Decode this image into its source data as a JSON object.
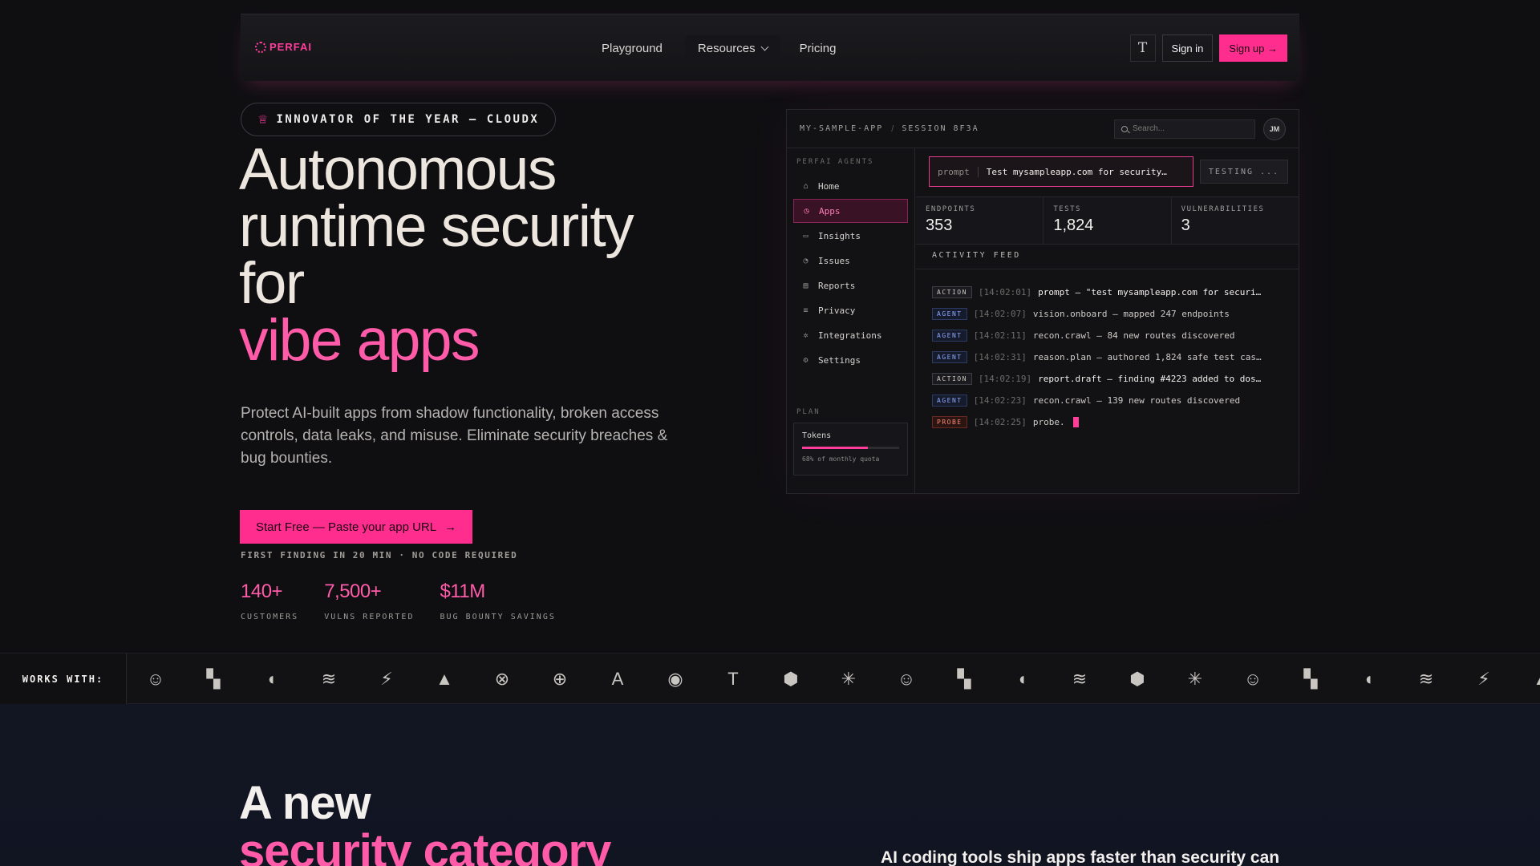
{
  "nav": {
    "logo_text": "PERFAI",
    "links": [
      "Playground",
      "Resources",
      "Pricing"
    ],
    "theme_icon": "T",
    "sign_in": "Sign in",
    "sign_up": "Sign up →"
  },
  "hero": {
    "badge": "INNOVATOR OF THE YEAR — CLOUDX",
    "headline": [
      "Autonomous",
      "runtime security",
      "for"
    ],
    "headline_accent": "vibe apps",
    "subtext": "Protect AI-built apps from shadow functionality, broken access controls, data leaks, and misuse. Eliminate security breaches & bug bounties.",
    "cta": "Start Free — Paste your app URL",
    "cta_sub": "FIRST FINDING IN 20 MIN · NO CODE REQUIRED",
    "stats": [
      {
        "value": "140+",
        "label": "CUSTOMERS"
      },
      {
        "value": "7,500+",
        "label": "VULNS REPORTED"
      },
      {
        "value": "$11M",
        "label": "BUG BOUNTY SAVINGS"
      }
    ]
  },
  "panel": {
    "breadcrumb": [
      "MY-SAMPLE-APP",
      "SESSION 8F3A"
    ],
    "search_placeholder": "Search...",
    "avatar": "JM",
    "sidebar_title": "PERFAI AGENTS",
    "sidebar_items": [
      {
        "label": "Home",
        "icon": "⌂"
      },
      {
        "label": "Apps",
        "icon": "◷"
      },
      {
        "label": "Insights",
        "icon": "▭"
      },
      {
        "label": "Issues",
        "icon": "◔"
      },
      {
        "label": "Reports",
        "icon": "▤"
      },
      {
        "label": "Privacy",
        "icon": "≡"
      },
      {
        "label": "Integrations",
        "icon": "✲"
      },
      {
        "label": "Settings",
        "icon": "⚙"
      }
    ],
    "active_item": "Apps",
    "plan_title": "PLAN",
    "plan_label": "Tokens",
    "plan_progress": 0.68,
    "plan_sub": "68% of monthly quota",
    "prompt_label": "prompt",
    "prompt_text": "Test mysampleapp.com for security…",
    "status": "TESTING ...",
    "metrics": [
      {
        "label": "ENDPOINTS",
        "value": "353"
      },
      {
        "label": "TESTS",
        "value": "1,824"
      },
      {
        "label": "VULNERABILITIES",
        "value": "3"
      }
    ],
    "feed_title": "ACTIVITY FEED",
    "feed": [
      {
        "tag": "ACTION",
        "time": "[14:02:01]",
        "msg": "prompt — \"test mysampleapp.com for securi…"
      },
      {
        "tag": "AGENT",
        "time": "[14:02:07]",
        "msg": "vision.onboard — mapped 247 endpoints"
      },
      {
        "tag": "AGENT",
        "time": "[14:02:11]",
        "msg": "recon.crawl — 84 new routes discovered"
      },
      {
        "tag": "AGENT",
        "time": "[14:02:31]",
        "msg": "reason.plan — authored 1,824 safe test cas…"
      },
      {
        "tag": "ACTION",
        "time": "[14:02:19]",
        "msg": "report.draft — finding #4223 added to dos…"
      },
      {
        "tag": "AGENT",
        "time": "[14:02:23]",
        "msg": "recon.crawl — 139 new routes discovered"
      },
      {
        "tag": "PROBE",
        "time": "[14:02:25]",
        "msg": "probe."
      }
    ]
  },
  "works_with": {
    "label": "WORKS WITH:",
    "logos": [
      "☺",
      "▚",
      "◖",
      "≋",
      "⚡",
      "▲",
      "⊗",
      "⊕",
      "A",
      "◉",
      "T",
      "⬢",
      "✳",
      "☺",
      "▚",
      "◖",
      "≋",
      "⬢",
      "✳",
      "☺",
      "▚",
      "◖",
      "≋",
      "⚡",
      "▲"
    ]
  },
  "section2": {
    "title": "A new",
    "title_accent": "security category",
    "side_text": "AI coding tools ship apps faster than security can"
  }
}
